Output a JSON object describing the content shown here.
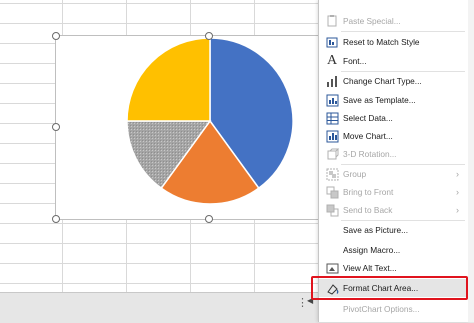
{
  "chart": {
    "handles": [
      "top-left",
      "top-center",
      "top-right",
      "middle-left",
      "middle-right",
      "bottom-left",
      "bottom-center",
      "bottom-right"
    ]
  },
  "chart_data": {
    "type": "pie",
    "values": [
      40,
      20,
      15,
      25
    ],
    "colors": [
      "#4472c4",
      "#ed7d31",
      "#a5a5a5",
      "#ffc000"
    ]
  },
  "context_menu": {
    "items": [
      {
        "label": "Paste Special...",
        "icon": "paste-special-icon",
        "disabled": true
      },
      {
        "label": "Reset to Match Style",
        "icon": "reset-style-icon",
        "disabled": false
      },
      {
        "label": "Font...",
        "icon": "font-icon",
        "disabled": false
      },
      {
        "label": "Change Chart Type...",
        "icon": "chart-type-icon",
        "disabled": false
      },
      {
        "label": "Save as Template...",
        "icon": "template-icon",
        "disabled": false
      },
      {
        "label": "Select Data...",
        "icon": "select-data-icon",
        "disabled": false
      },
      {
        "label": "Move Chart...",
        "icon": "move-chart-icon",
        "disabled": false
      },
      {
        "label": "3-D Rotation...",
        "icon": "rotation-icon",
        "disabled": true
      },
      {
        "label": "Group",
        "icon": "group-icon",
        "disabled": true
      },
      {
        "label": "Bring to Front",
        "icon": "bring-front-icon",
        "disabled": true
      },
      {
        "label": "Send to Back",
        "icon": "send-back-icon",
        "disabled": true
      },
      {
        "label": "Save as Picture...",
        "icon": "",
        "disabled": false
      },
      {
        "label": "Assign Macro...",
        "icon": "",
        "disabled": false
      },
      {
        "label": "View Alt Text...",
        "icon": "alt-text-icon",
        "disabled": false
      },
      {
        "label": "Format Chart Area...",
        "icon": "format-area-icon",
        "disabled": false
      },
      {
        "label": "PivotChart Options...",
        "icon": "",
        "disabled": true
      }
    ]
  },
  "colors": {
    "highlight": "#e0141e",
    "menu_hover": "#e5e5e5",
    "icon_blue": "#2b579a"
  }
}
